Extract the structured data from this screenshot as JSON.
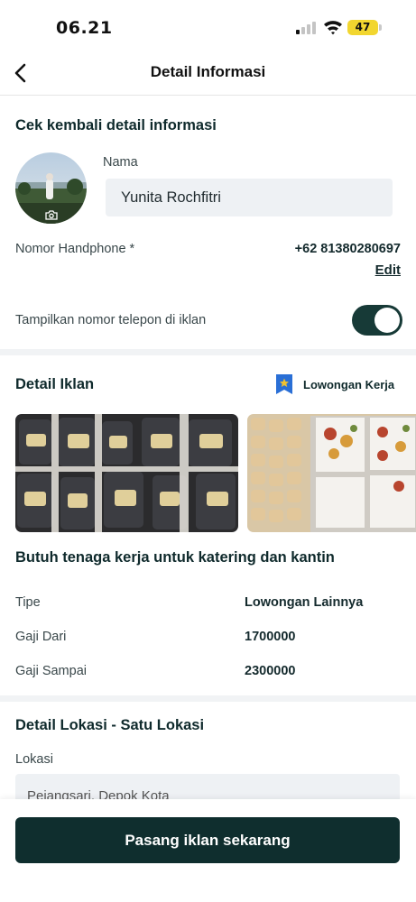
{
  "status_bar": {
    "time": "06.21",
    "battery": "47"
  },
  "header": {
    "title": "Detail Informasi"
  },
  "profile_section": {
    "title": "Cek kembali detail informasi",
    "name_label": "Nama",
    "name_value": "Yunita Rochfitri",
    "phone_label": "Nomor Handphone *",
    "phone_value": "+62 81380280697",
    "edit_label": "Edit",
    "show_phone_label": "Tampilkan nomor telepon di iklan",
    "show_phone_enabled": true
  },
  "ad_section": {
    "title": "Detail Iklan",
    "category": "Lowongan Kerja",
    "headline": "Butuh tenaga kerja untuk katering dan kantin",
    "details": [
      {
        "label": "Tipe",
        "value": "Lowongan Lainnya"
      },
      {
        "label": "Gaji Dari",
        "value": "1700000"
      },
      {
        "label": "Gaji Sampai",
        "value": "2300000"
      }
    ]
  },
  "location_section": {
    "title": "Detail Lokasi - Satu Lokasi",
    "location_label": "Lokasi",
    "location_value": "Pejangsari, Depok Kota"
  },
  "footer": {
    "cta_label": "Pasang iklan sekarang"
  },
  "colors": {
    "primary": "#0f2e2e",
    "toggle_on": "#173a37",
    "input_bg": "#eef1f4",
    "badge_blue": "#2a6fd6",
    "badge_star": "#f2c230"
  }
}
